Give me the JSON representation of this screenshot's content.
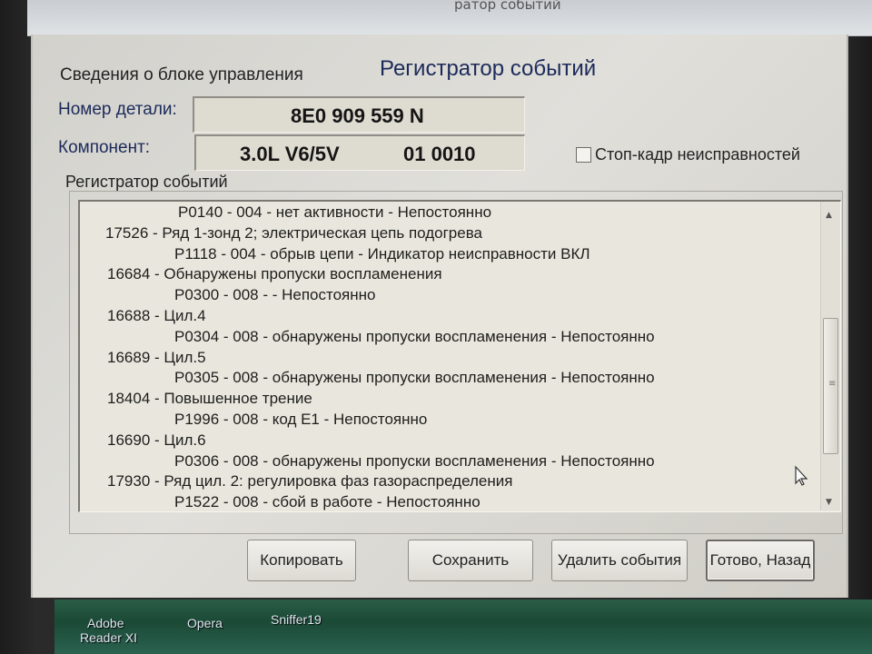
{
  "top_title_fragment": "ратор событий",
  "window": {
    "title": "Регистратор событий",
    "group_label": "Сведения о блоке управления",
    "part_number_label": "Номер детали:",
    "part_number_value": "8E0 909 559 N",
    "component_label": "Компонент:",
    "component_value": "3.0L V6/5V",
    "component_code": "01 0010",
    "freeze_frame_checkbox": "Стоп-кадр неисправностей",
    "log_label": "Регистратор событий",
    "log_lines": [
      "P0140 - 004 - нет активности - Непостоянно",
      "17526 - Ряд 1-зонд 2; электрическая цепь подогрева",
      "P1118 - 004 - обрыв цепи - Индикатор неисправности ВКЛ",
      "16684 - Обнаружены пропуски воспламенения",
      "P0300 - 008 -  - Непостоянно",
      "16688 - Цил.4",
      "P0304 - 008 - обнаружены пропуски воспламенения - Непостоянно",
      "16689 - Цил.5",
      "P0305 - 008 - обнаружены пропуски воспламенения - Непостоянно",
      "18404 - Повышенное трение",
      "P1996 - 008 - код E1 - Непостоянно",
      "16690 - Цил.6",
      "P0306 - 008 - обнаружены пропуски воспламенения - Непостоянно",
      "17930 - Ряд цил. 2: регулировка фаз газораспределения",
      "P1522 - 008 - сбой в работе - Непостоянно"
    ],
    "buttons": {
      "copy": "Копировать",
      "save": "Сохранить",
      "delete": "Удалить события",
      "done": "Готово, Назад"
    }
  },
  "desktop_icons": {
    "adobe_line1": "Adobe",
    "adobe_line2": "Reader XI",
    "opera": "Opera",
    "sniffer": "Sniffer19"
  }
}
